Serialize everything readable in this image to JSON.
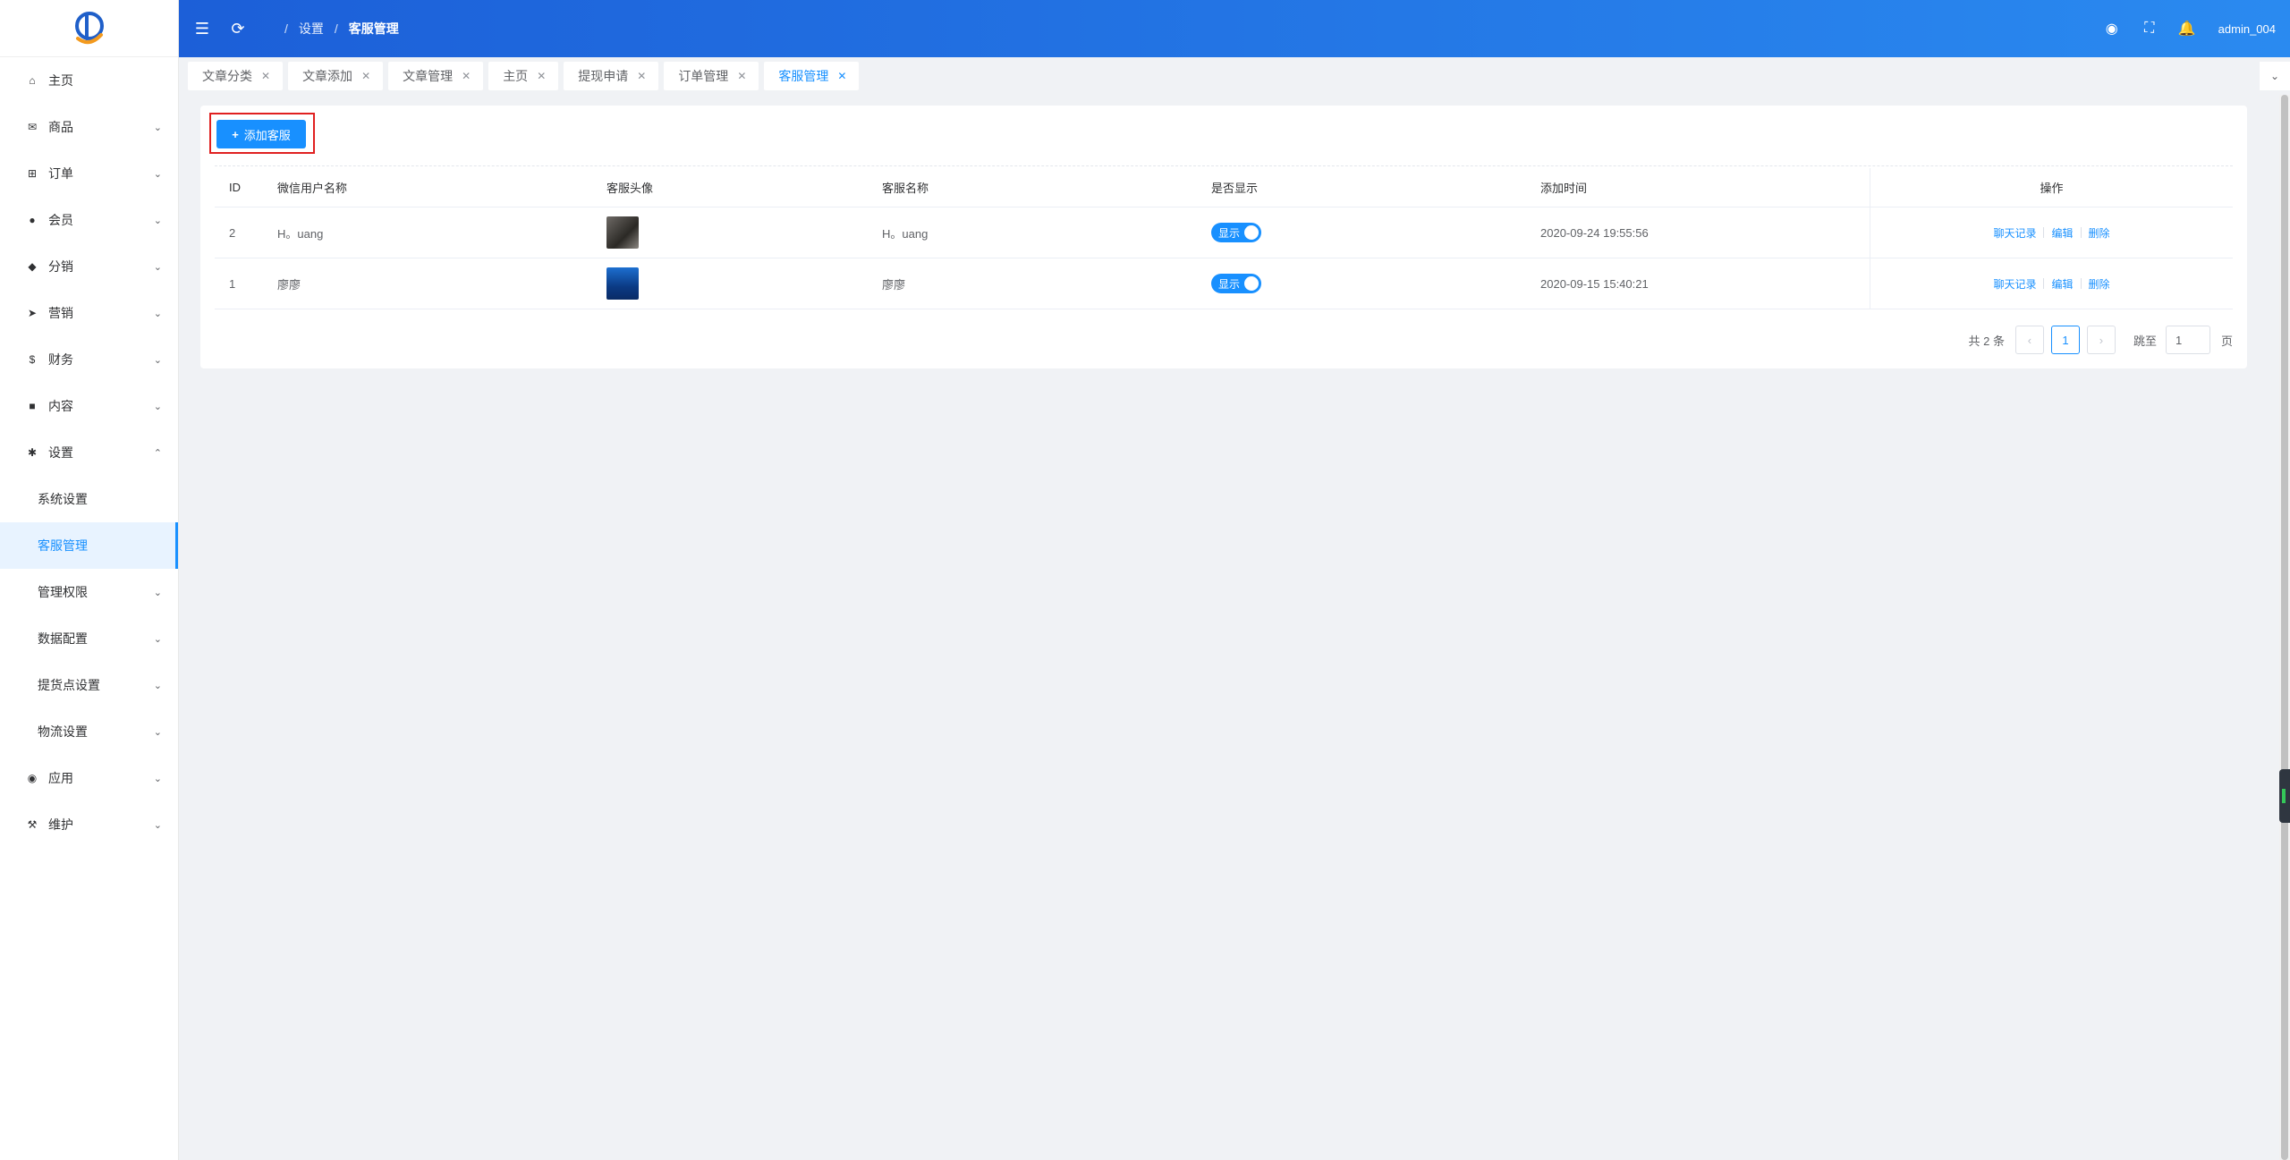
{
  "header": {
    "breadcrumb": [
      "设置",
      "客服管理"
    ],
    "username": "admin_004"
  },
  "sidebar": {
    "items": [
      {
        "label": "主页",
        "icon": "home-icon",
        "glyph": "⌂",
        "arrow": ""
      },
      {
        "label": "商品",
        "icon": "goods-icon",
        "glyph": "✉",
        "arrow": "⌄"
      },
      {
        "label": "订单",
        "icon": "cart-icon",
        "glyph": "⊞",
        "arrow": "⌄"
      },
      {
        "label": "会员",
        "icon": "user-icon",
        "glyph": "●",
        "arrow": "⌄"
      },
      {
        "label": "分销",
        "icon": "distribution-icon",
        "glyph": "◆",
        "arrow": "⌄"
      },
      {
        "label": "营销",
        "icon": "marketing-icon",
        "glyph": "➤",
        "arrow": "⌄"
      },
      {
        "label": "财务",
        "icon": "dollar-icon",
        "glyph": "$",
        "arrow": "⌄"
      },
      {
        "label": "内容",
        "icon": "book-icon",
        "glyph": "■",
        "arrow": "⌄"
      },
      {
        "label": "设置",
        "icon": "gear-icon",
        "glyph": "✱",
        "arrow": "⌃"
      }
    ],
    "sub_items": [
      {
        "label": "系统设置",
        "arrow": ""
      },
      {
        "label": "客服管理",
        "arrow": ""
      },
      {
        "label": "管理权限",
        "arrow": "⌄"
      },
      {
        "label": "数据配置",
        "arrow": "⌄"
      },
      {
        "label": "提货点设置",
        "arrow": "⌄"
      },
      {
        "label": "物流设置",
        "arrow": "⌄"
      }
    ],
    "tail_items": [
      {
        "label": "应用",
        "icon": "app-icon",
        "glyph": "◉",
        "arrow": "⌄"
      },
      {
        "label": "维护",
        "icon": "wrench-icon",
        "glyph": "⚒",
        "arrow": "⌄"
      }
    ]
  },
  "tabs": [
    "文章分类",
    "文章添加",
    "文章管理",
    "主页",
    "提现申请",
    "订单管理",
    "客服管理"
  ],
  "toolbar": {
    "add_label": "添加客服"
  },
  "table": {
    "columns": [
      "ID",
      "微信用户名称",
      "客服头像",
      "客服名称",
      "是否显示",
      "添加时间",
      "操作"
    ],
    "rows": [
      {
        "id": "2",
        "wx_name": "H。uang",
        "name": "H。uang",
        "show": "显示",
        "time": "2020-09-24 19:55:56"
      },
      {
        "id": "1",
        "wx_name": "廖廖",
        "name": "廖廖",
        "show": "显示",
        "time": "2020-09-15 15:40:21"
      }
    ],
    "actions": [
      "聊天记录",
      "编辑",
      "删除"
    ]
  },
  "pagination": {
    "total_text": "共 2 条",
    "current_page": "1",
    "jump_label": "跳至",
    "jump_value": "1",
    "unit": "页"
  },
  "colors": {
    "accent": "#1890ff",
    "header_start": "#1c5fd8",
    "header_end": "#2a8af0",
    "highlight_border": "#e02020"
  }
}
